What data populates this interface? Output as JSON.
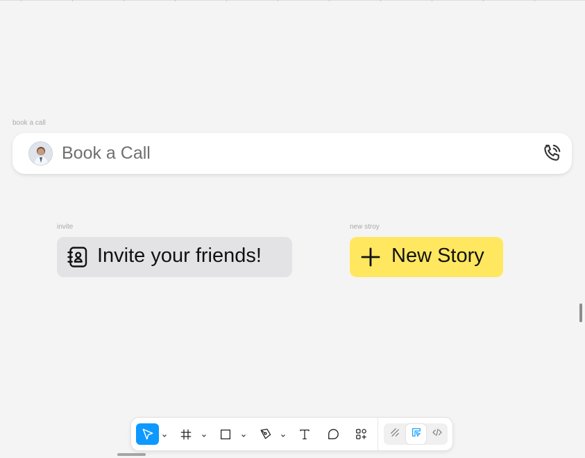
{
  "frames": {
    "book_call_label": "book a call",
    "invite_label": "invite",
    "new_story_label": "new stroy"
  },
  "call_bar": {
    "label": "Book a Call",
    "avatar_icon": "user-avatar",
    "phone_icon": "phone-call-icon"
  },
  "invite_button": {
    "label": "Invite your friends!",
    "icon": "contact-book-icon",
    "background": "#e3e3e6"
  },
  "new_story_button": {
    "label": "New Story",
    "icon": "plus-icon",
    "background": "#ffe760"
  },
  "toolbar": {
    "tools": [
      {
        "name": "move-tool",
        "icon": "cursor-icon",
        "active": true
      },
      {
        "name": "frame-tool",
        "icon": "frame-hash-icon"
      },
      {
        "name": "shape-tool",
        "icon": "rectangle-icon"
      },
      {
        "name": "pen-tool",
        "icon": "pen-icon"
      },
      {
        "name": "text-tool",
        "icon": "text-icon"
      },
      {
        "name": "comment-tool",
        "icon": "comment-icon"
      },
      {
        "name": "actions-tool",
        "icon": "actions-icon"
      }
    ],
    "modes": [
      {
        "name": "draw-mode",
        "icon": "draw-icon"
      },
      {
        "name": "design-mode",
        "icon": "design-icon",
        "selected": true
      },
      {
        "name": "dev-mode",
        "icon": "code-icon"
      }
    ],
    "accent_color": "#0d99ff"
  }
}
